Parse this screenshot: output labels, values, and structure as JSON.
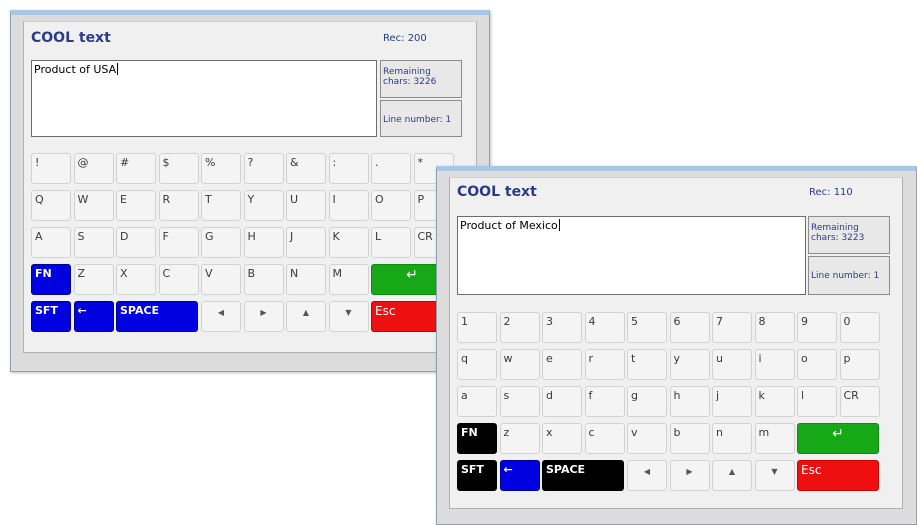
{
  "window1": {
    "title": "COOL text",
    "rec": "Rec: 200",
    "text": "Product of USA",
    "remaining": "Remaining chars: 3226",
    "line_number": "Line number: 1",
    "rows": [
      [
        "!",
        "@",
        "#",
        "$",
        "%",
        "?",
        "&",
        ":",
        ".",
        "*"
      ],
      [
        "Q",
        "W",
        "E",
        "R",
        "T",
        "Y",
        "U",
        "I",
        "O",
        "P"
      ],
      [
        "A",
        "S",
        "D",
        "F",
        "G",
        "H",
        "J",
        "K",
        "L",
        "CR"
      ],
      [
        "FN",
        "Z",
        "X",
        "C",
        "V",
        "B",
        "N",
        "M"
      ]
    ],
    "bottom": {
      "sft": "SFT",
      "back": "←",
      "space": "SPACE",
      "left": "◀",
      "right": "▶",
      "up": "▲",
      "down": "▼",
      "esc": "Esc"
    },
    "enter": "↵",
    "colors": {
      "fn": "#0000e0",
      "sft": "#0000e0",
      "back": "#0000e0",
      "space": "#0000e0",
      "enter": "#16a816",
      "esc": "#ee1010"
    }
  },
  "window2": {
    "title": "COOL text",
    "rec": "Rec: 110",
    "text": "Product of Mexico",
    "remaining": "Remaining chars: 3223",
    "line_number": "Line number: 1",
    "rows": [
      [
        "1",
        "2",
        "3",
        "4",
        "5",
        "6",
        "7",
        "8",
        "9",
        "0"
      ],
      [
        "q",
        "w",
        "e",
        "r",
        "t",
        "y",
        "u",
        "i",
        "o",
        "p"
      ],
      [
        "a",
        "s",
        "d",
        "f",
        "g",
        "h",
        "j",
        "k",
        "l",
        "CR"
      ],
      [
        "FN",
        "z",
        "x",
        "c",
        "v",
        "b",
        "n",
        "m"
      ]
    ],
    "bottom": {
      "sft": "SFT",
      "back": "←",
      "space": "SPACE",
      "left": "◀",
      "right": "▶",
      "up": "▲",
      "down": "▼",
      "esc": "Esc"
    },
    "enter": "↵",
    "colors": {
      "fn": "#000000",
      "sft": "#000000",
      "back": "#0000e0",
      "space": "#000000",
      "enter": "#16a816",
      "esc": "#ee1010"
    }
  }
}
